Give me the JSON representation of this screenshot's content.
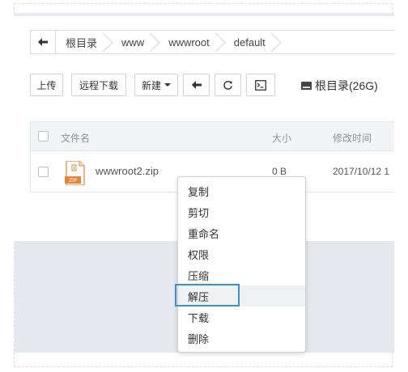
{
  "breadcrumb": {
    "back_icon": "arrow-left-icon",
    "items": [
      "根目录",
      "www",
      "wwwroot",
      "default"
    ]
  },
  "toolbar": {
    "upload": "上传",
    "remote_download": "远程下载",
    "new": "新建",
    "back_icon": "arrow-left-icon",
    "refresh_icon": "refresh-icon",
    "terminal_icon": "terminal-icon",
    "disk_label": "根目录(26G)"
  },
  "table": {
    "headers": {
      "name": "文件名",
      "size": "大小",
      "modified": "修改时间"
    },
    "rows": [
      {
        "name": "wwwroot2.zip",
        "size": "0 B",
        "modified": "2017/10/12 1",
        "icon_label": "ZIP"
      }
    ]
  },
  "context_menu": {
    "items": [
      "复制",
      "剪切",
      "重命名",
      "权限",
      "压缩",
      "解压",
      "下载",
      "删除"
    ],
    "hovered": "解压"
  },
  "colors": {
    "highlight": "#3a8fd6",
    "zip_orange": "#e8833a"
  }
}
